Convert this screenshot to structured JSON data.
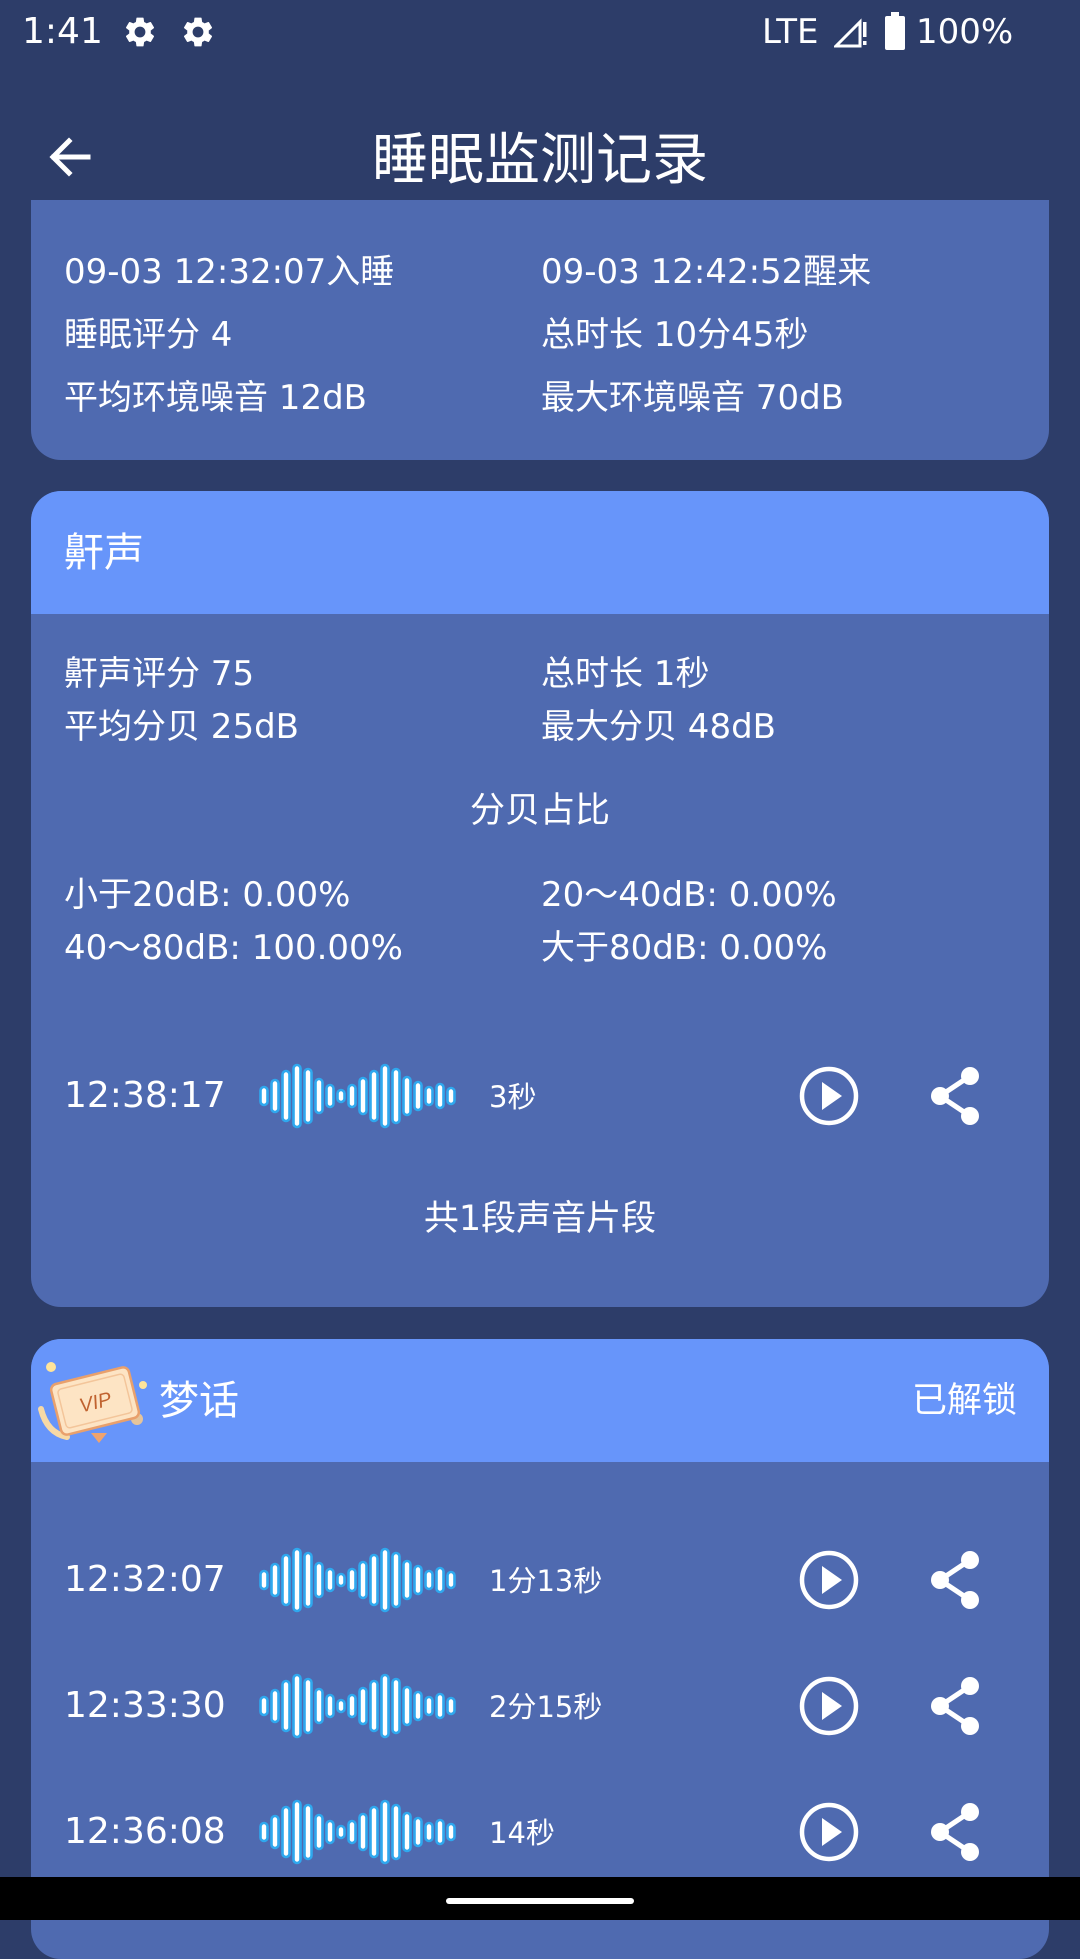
{
  "status_bar": {
    "time": "1:41",
    "network": "LTE",
    "battery": "100%"
  },
  "toolbar": {
    "title": "睡眠监测记录"
  },
  "summary": {
    "sleep_start": "09-03 12:32:07入睡",
    "wake_time": "09-03 12:42:52醒来",
    "sleep_score": "睡眠评分 4",
    "total_duration": "总时长 10分45秒",
    "avg_noise": "平均环境噪音 12dB",
    "max_noise": "最大环境噪音 70dB"
  },
  "snore": {
    "title": "鼾声",
    "score": "鼾声评分 75",
    "total_duration": "总时长 1秒",
    "avg_db": "平均分贝 25dB",
    "max_db": "最大分贝 48dB",
    "ratio_title": "分贝占比",
    "ratio_lt20": "小于20dB: 0.00%",
    "ratio_20_40": "20～40dB: 0.00%",
    "ratio_40_80": "40～80dB: 100.00%",
    "ratio_gt80": "大于80dB: 0.00%",
    "records": [
      {
        "time": "12:38:17",
        "duration": "3秒"
      }
    ],
    "footer": "共1段声音片段"
  },
  "dream": {
    "title": "梦话",
    "vip_text": "VIP",
    "unlock_status": "已解锁",
    "records": [
      {
        "time": "12:32:07",
        "duration": "1分13秒"
      },
      {
        "time": "12:33:30",
        "duration": "2分15秒"
      },
      {
        "time": "12:36:08",
        "duration": "14秒"
      }
    ]
  },
  "icons": {
    "back": "arrow-left-icon",
    "settings": "gear-icon",
    "play": "play-circle-icon",
    "share": "share-icon",
    "waveform": "waveform-icon",
    "vip": "vip-ticket-icon"
  },
  "colors": {
    "page_background": "#2d3d69",
    "card_background": "#4f6ab0",
    "card_header": "#6795fa",
    "waveform_stroke": "#2fa8ee",
    "text": "#ffffff"
  }
}
